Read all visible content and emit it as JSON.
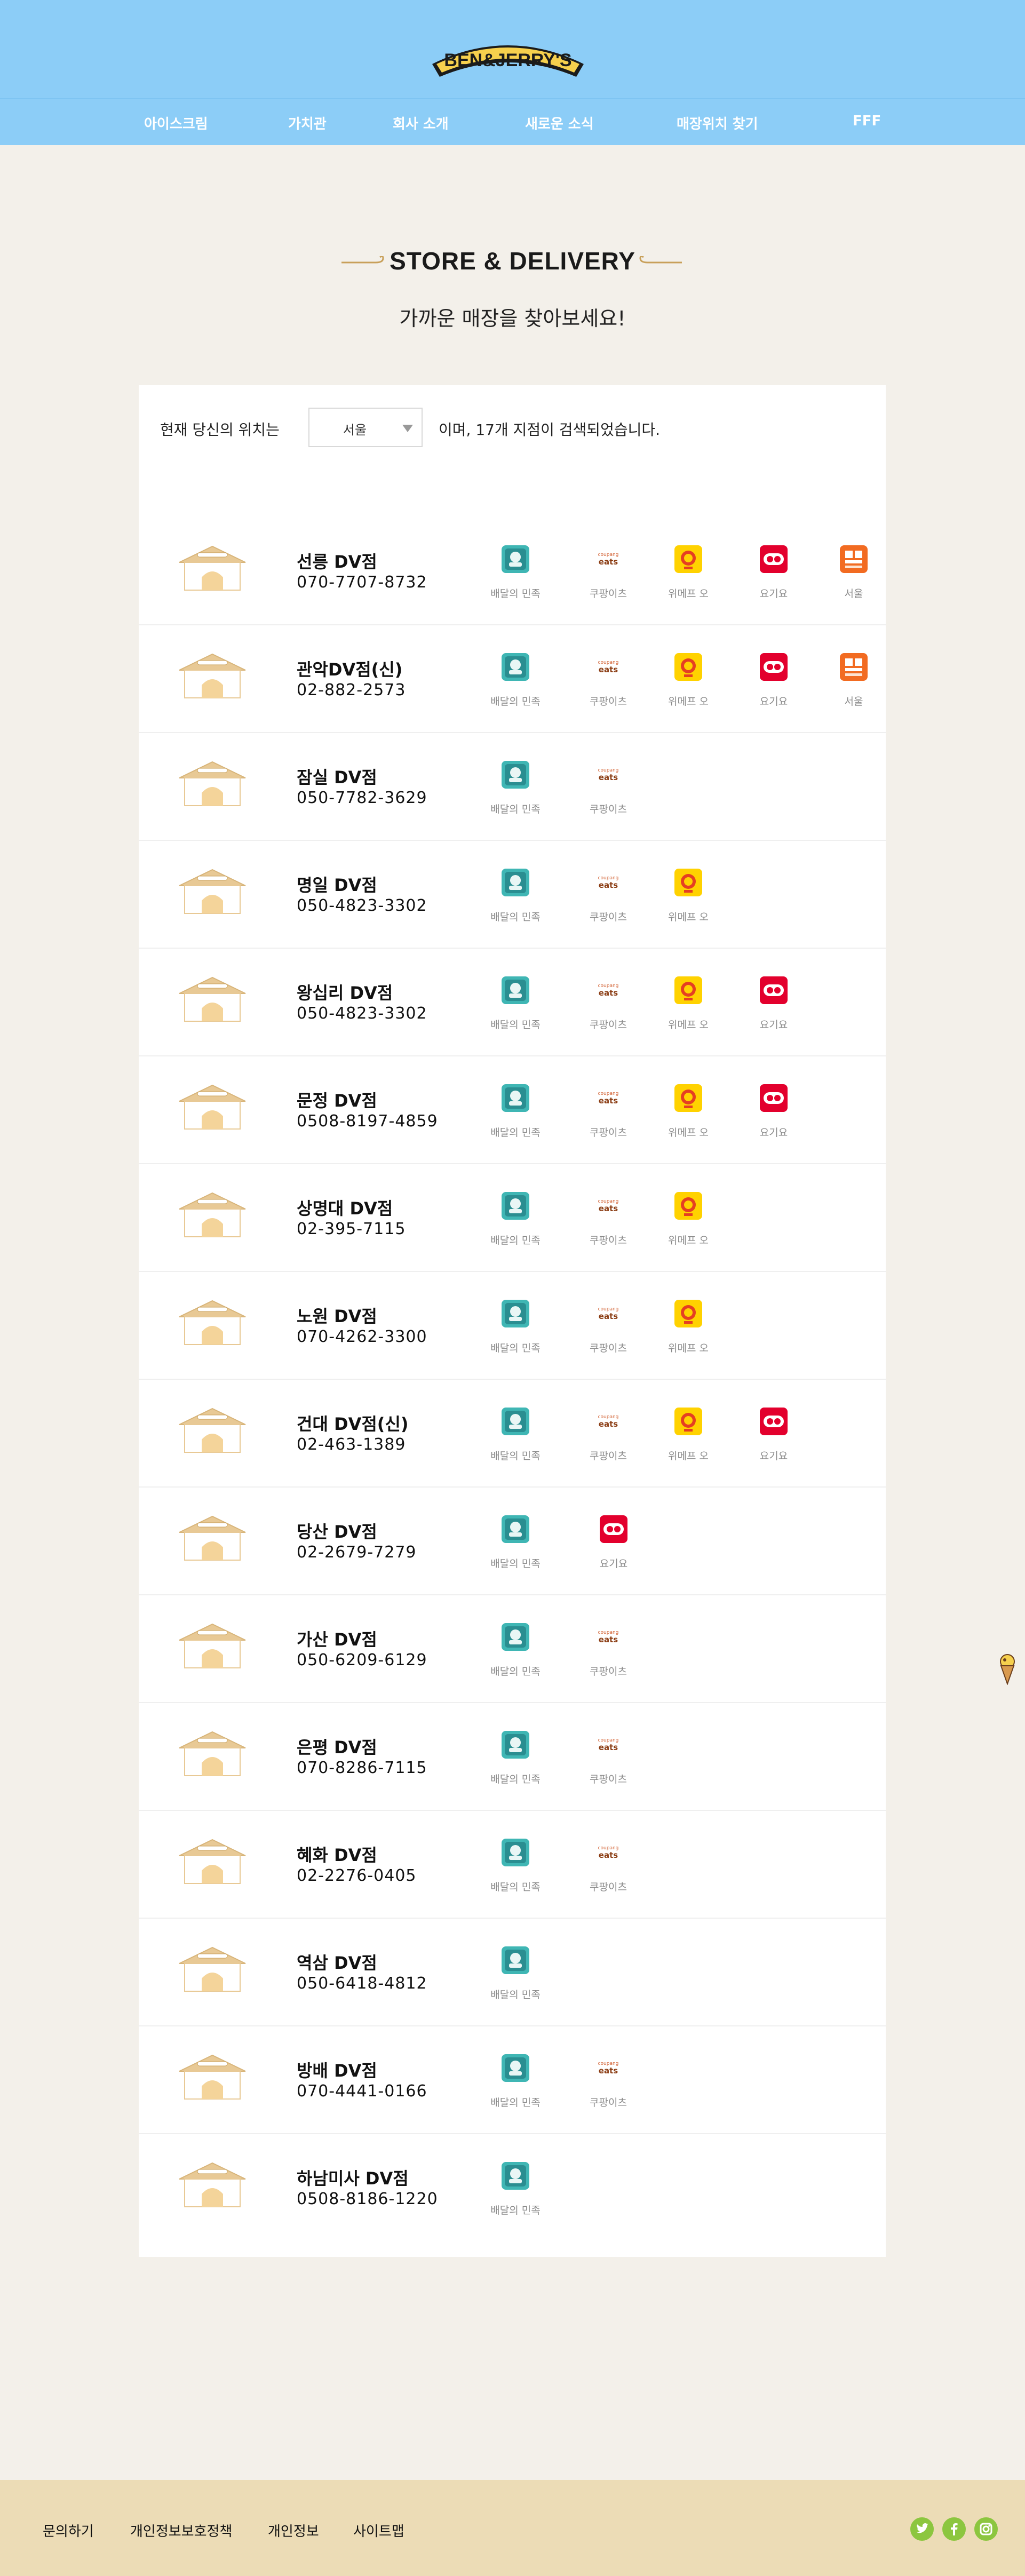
{
  "header": {
    "logo_text": "BEN&JERRY'S",
    "nav": [
      {
        "label": "아이스크림"
      },
      {
        "label": "가치관"
      },
      {
        "label": "회사 소개"
      },
      {
        "label": "새로운 소식"
      },
      {
        "label": "매장위치 찾기"
      },
      {
        "label": "FFF"
      }
    ]
  },
  "page": {
    "title": "STORE & DELIVERY",
    "subtitle": "가까운 매장을 찾아보세요!"
  },
  "location": {
    "prefix": "현재 당신의 위치는",
    "selected": "서울",
    "suffix": "이며, 17개 지점이 검색되었습니다."
  },
  "services": {
    "baemin": {
      "label": "배달의 민족",
      "icon": "baemin-icon",
      "color": "#3fb6b4"
    },
    "coupang": {
      "label": "쿠팡이츠",
      "icon": "coupang-eats-icon",
      "color": "#b3501c"
    },
    "wemef": {
      "label": "위메프 오",
      "icon": "wemakeprice-o-icon",
      "color": "#ffd200"
    },
    "yogiyo": {
      "label": "요기요",
      "icon": "yogiyo-icon",
      "color": "#e3002d"
    },
    "seoul": {
      "label": "서울",
      "icon": "seoul-icon",
      "color": "#f26b21"
    }
  },
  "stores": [
    {
      "name": "선릉 DV점",
      "phone": "070-7707-8732",
      "services": [
        "baemin",
        "coupang",
        "wemef",
        "yogiyo",
        "seoul"
      ]
    },
    {
      "name": "관악DV점(신)",
      "phone": "02-882-2573",
      "services": [
        "baemin",
        "coupang",
        "wemef",
        "yogiyo",
        "seoul"
      ]
    },
    {
      "name": "잠실 DV점",
      "phone": "050-7782-3629",
      "services": [
        "baemin",
        "coupang"
      ]
    },
    {
      "name": "명일 DV점",
      "phone": "050-4823-3302",
      "services": [
        "baemin",
        "coupang",
        "wemef"
      ]
    },
    {
      "name": "왕십리 DV점",
      "phone": "050-4823-3302",
      "services": [
        "baemin",
        "coupang",
        "wemef",
        "yogiyo"
      ]
    },
    {
      "name": "문정 DV점",
      "phone": "0508-8197-4859",
      "services": [
        "baemin",
        "coupang",
        "wemef",
        "yogiyo"
      ]
    },
    {
      "name": "상명대 DV점",
      "phone": "02-395-7115",
      "services": [
        "baemin",
        "coupang",
        "wemef"
      ]
    },
    {
      "name": "노원 DV점",
      "phone": "070-4262-3300",
      "services": [
        "baemin",
        "coupang",
        "wemef"
      ]
    },
    {
      "name": "건대 DV점(신)",
      "phone": "02-463-1389",
      "services": [
        "baemin",
        "coupang",
        "wemef",
        "yogiyo"
      ]
    },
    {
      "name": "당산 DV점",
      "phone": "02-2679-7279",
      "services": [
        "baemin",
        "yogiyo"
      ]
    },
    {
      "name": "가산 DV점",
      "phone": "050-6209-6129",
      "services": [
        "baemin",
        "coupang"
      ]
    },
    {
      "name": "은평 DV점",
      "phone": "070-8286-7115",
      "services": [
        "baemin",
        "coupang"
      ]
    },
    {
      "name": "혜화 DV점",
      "phone": "02-2276-0405",
      "services": [
        "baemin",
        "coupang"
      ]
    },
    {
      "name": "역삼 DV점",
      "phone": "050-6418-4812",
      "services": [
        "baemin"
      ]
    },
    {
      "name": "방배 DV점",
      "phone": "070-4441-0166",
      "services": [
        "baemin",
        "coupang"
      ]
    },
    {
      "name": "하남미사 DV점",
      "phone": "0508-8186-1220",
      "services": [
        "baemin"
      ]
    }
  ],
  "footer": {
    "links": [
      {
        "label": "문의하기"
      },
      {
        "label": "개인정보보호정책"
      },
      {
        "label": "개인정보"
      },
      {
        "label": "사이트맵"
      }
    ],
    "social": [
      "twitter-icon",
      "facebook-icon",
      "instagram-icon"
    ]
  },
  "colors": {
    "header": "#8ccdf7",
    "background": "#f3f0ea",
    "footer": "#ecdcb6",
    "accent_gold": "#c8a05a",
    "social": "#8cc63f"
  }
}
